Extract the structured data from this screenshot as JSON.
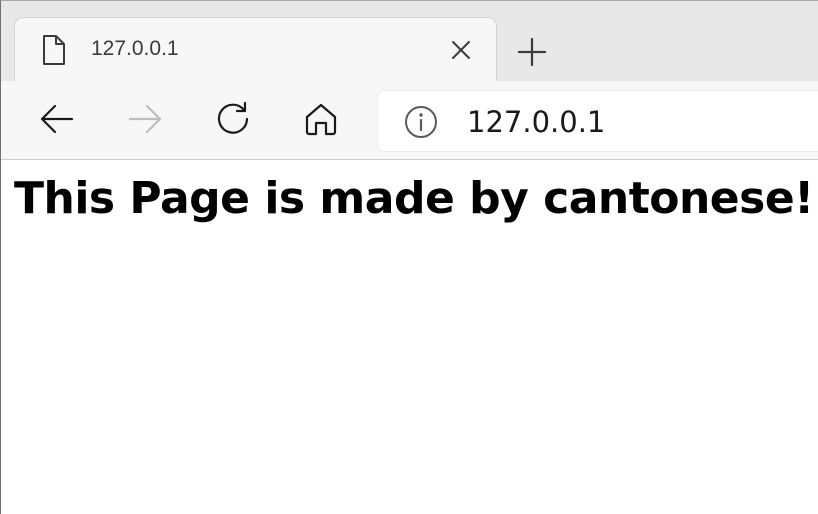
{
  "browser": {
    "tab": {
      "title": "127.0.0.1",
      "favicon_icon": "document-icon",
      "close_icon": "close-icon"
    },
    "new_tab_icon": "plus-icon",
    "toolbar": {
      "back_icon": "arrow-left-icon",
      "forward_icon": "arrow-right-icon",
      "forward_enabled": false,
      "refresh_icon": "refresh-icon",
      "home_icon": "home-icon"
    },
    "address_bar": {
      "site_info_icon": "info-icon",
      "url": "127.0.0.1"
    }
  },
  "page": {
    "heading": "This Page is made by cantonese!"
  },
  "colors": {
    "tabstrip_bg": "#e8e8e8",
    "toolbar_bg": "#f7f7f7",
    "icon_active": "#1a1a1a",
    "icon_disabled": "#bdbdbd",
    "page_bg": "#ffffff"
  }
}
